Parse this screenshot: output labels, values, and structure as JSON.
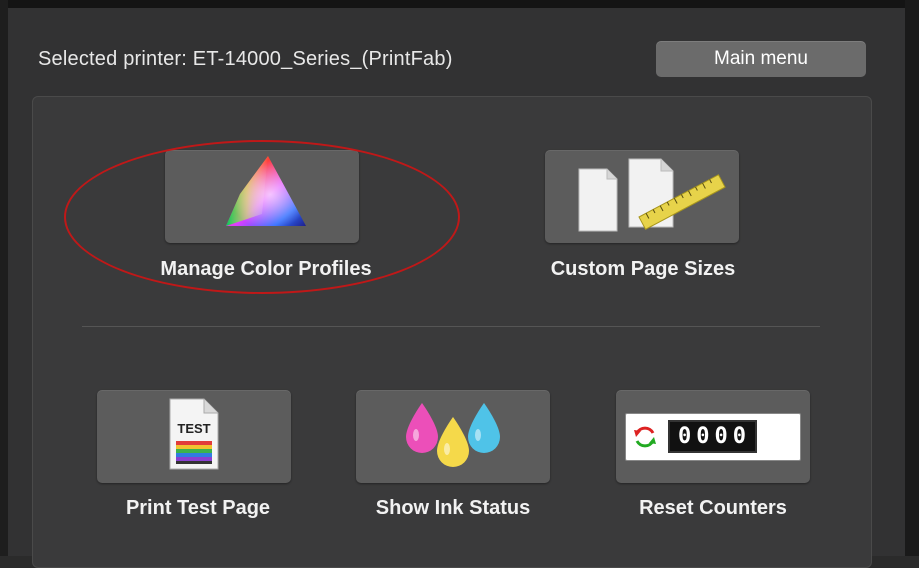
{
  "header": {
    "selected_printer": "Selected printer: ET-14000_Series_(PrintFab)",
    "main_menu_label": "Main menu"
  },
  "tiles": {
    "color_profiles": {
      "label": "Manage Color Profiles",
      "icon": "color-gamut-icon"
    },
    "page_sizes": {
      "label": "Custom Page Sizes",
      "icon": "pages-ruler-icon"
    },
    "test_page": {
      "label": "Print Test Page",
      "icon": "test-page-icon",
      "doc_text": "TEST"
    },
    "ink_status": {
      "label": "Show Ink Status",
      "icon": "ink-drops-icon"
    },
    "reset_counters": {
      "label": "Reset Counters",
      "icon": "counter-icon",
      "counter_value": "0000"
    }
  },
  "colors": {
    "background": "#323233",
    "tile": "#5c5c5c",
    "highlight": "#c01818",
    "ink_magenta": "#ec4fb9",
    "ink_yellow": "#f5d94a",
    "ink_cyan": "#4fc3e8"
  }
}
